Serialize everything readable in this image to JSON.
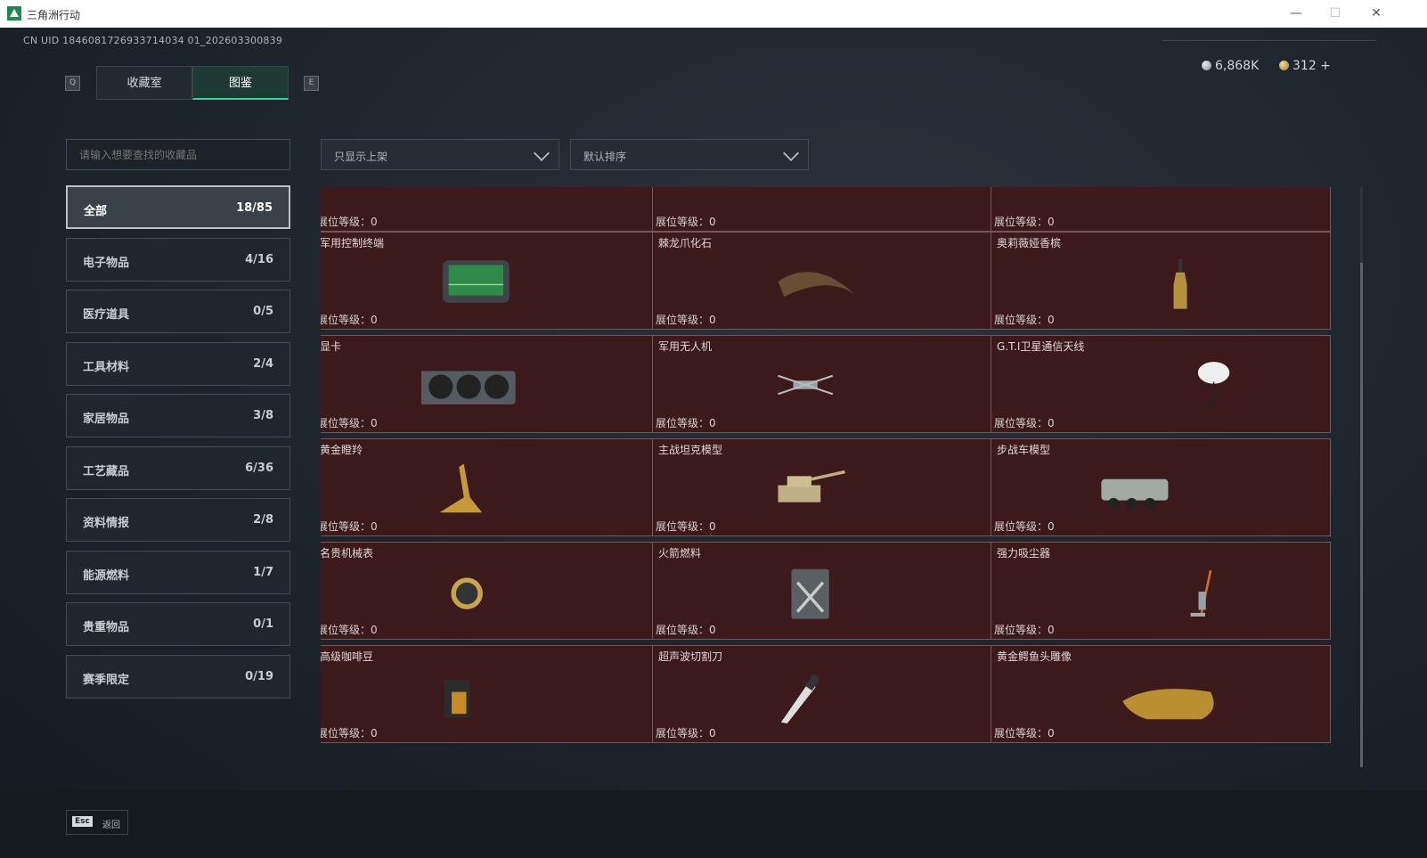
{
  "window": {
    "title": "三角洲行动",
    "minimize": "—",
    "maximize": "☐",
    "close": "✕"
  },
  "header": {
    "uid": "CN UID 1846081726933714034 01_202603300839",
    "left_key": "Q",
    "right_key": "E",
    "tabs": [
      {
        "label": "收藏室",
        "active": false
      },
      {
        "label": "图鉴",
        "active": true
      }
    ],
    "currency": [
      {
        "icon": "silver-coin-icon",
        "value": "6,868K"
      },
      {
        "icon": "gold-coin-icon",
        "value": "312 +"
      }
    ]
  },
  "search": {
    "placeholder": "请输入想要查找的收藏品"
  },
  "filters": {
    "display": "只显示上架",
    "sort": "默认排序"
  },
  "categories": [
    {
      "label": "全部",
      "count": "18/85",
      "active": true
    },
    {
      "label": "电子物品",
      "count": "4/16"
    },
    {
      "label": "医疗道具",
      "count": "0/5"
    },
    {
      "label": "工具材料",
      "count": "2/4"
    },
    {
      "label": "家居物品",
      "count": "3/8"
    },
    {
      "label": "工艺藏品",
      "count": "6/36"
    },
    {
      "label": "资料情报",
      "count": "2/8"
    },
    {
      "label": "能源燃料",
      "count": "1/7"
    },
    {
      "label": "贵重物品",
      "count": "0/1"
    },
    {
      "label": "赛季限定",
      "count": "0/19"
    }
  ],
  "level_label": "展位等级：",
  "items": [
    {
      "name": "",
      "level": "0",
      "icon": "usb-drive-icon"
    },
    {
      "name": "",
      "level": "0",
      "icon": "knife-icon"
    },
    {
      "name": "",
      "level": "0",
      "icon": "white-orb-icon"
    },
    {
      "name": "军用控制终端",
      "level": "0",
      "icon": "control-terminal-icon"
    },
    {
      "name": "棘龙爪化石",
      "level": "0",
      "icon": "claw-fossil-icon"
    },
    {
      "name": "奥莉薇娅香槟",
      "level": "0",
      "icon": "champagne-bottle-icon"
    },
    {
      "name": "显卡",
      "level": "0",
      "icon": "graphics-card-icon"
    },
    {
      "name": "军用无人机",
      "level": "0",
      "icon": "drone-icon"
    },
    {
      "name": "G.T.I卫星通信天线",
      "level": "0",
      "icon": "satellite-dish-icon"
    },
    {
      "name": "黄金瞪羚",
      "level": "0",
      "icon": "gold-gazelle-icon"
    },
    {
      "name": "主战坦克模型",
      "level": "0",
      "icon": "tank-model-icon"
    },
    {
      "name": "步战车模型",
      "level": "0",
      "icon": "ifv-model-icon"
    },
    {
      "name": "名贵机械表",
      "level": "0",
      "icon": "watch-icon"
    },
    {
      "name": "火箭燃料",
      "level": "0",
      "icon": "fuel-can-icon"
    },
    {
      "name": "强力吸尘器",
      "level": "0",
      "icon": "vacuum-icon"
    },
    {
      "name": "高级咖啡豆",
      "level": "0",
      "icon": "coffee-bag-icon"
    },
    {
      "name": "超声波切割刀",
      "level": "0",
      "icon": "ultrasonic-cutter-icon"
    },
    {
      "name": "黄金鳄鱼头雕像",
      "level": "0",
      "icon": "gold-crocodile-icon"
    }
  ],
  "footer": {
    "key": "Esc",
    "label": "返回"
  },
  "colors": {
    "accent": "#38d39b",
    "card_bg": "#3c1a1c",
    "card_border": "#7a5558"
  }
}
